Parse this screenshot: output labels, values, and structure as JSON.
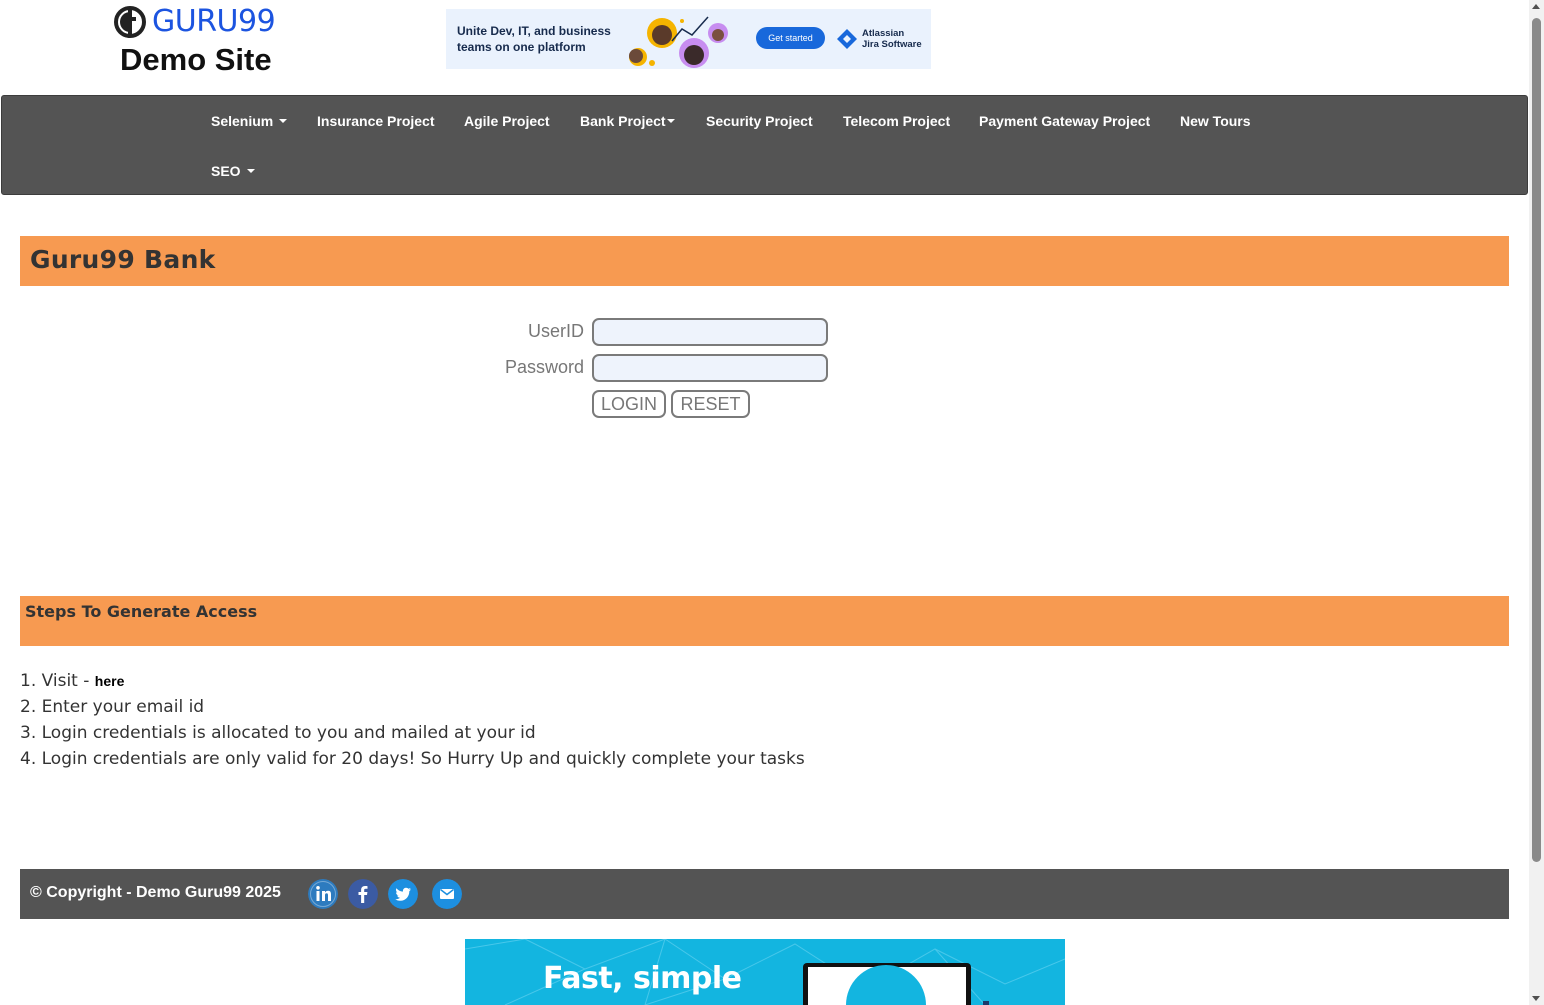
{
  "header": {
    "logo_text": "GURU99",
    "logo_subtitle": "Demo Site"
  },
  "top_ad": {
    "text": "Unite Dev, IT, and business teams on one platform",
    "button": "Get started",
    "brand_line1": "Atlassian",
    "brand_line2": "Jira Software"
  },
  "nav": {
    "items": [
      {
        "label": "Selenium",
        "dropdown": true
      },
      {
        "label": "Insurance Project",
        "dropdown": false
      },
      {
        "label": "Agile Project",
        "dropdown": false
      },
      {
        "label": "Bank Project",
        "dropdown": true
      },
      {
        "label": "Security Project",
        "dropdown": false
      },
      {
        "label": "Telecom Project",
        "dropdown": false
      },
      {
        "label": "Payment Gateway Project",
        "dropdown": false
      },
      {
        "label": "New Tours",
        "dropdown": false
      },
      {
        "label": "SEO",
        "dropdown": true
      }
    ]
  },
  "bank": {
    "title": "Guru99 Bank"
  },
  "login_form": {
    "userid_label": "UserID",
    "userid_value": "",
    "password_label": "Password",
    "password_value": "",
    "login_button": "LOGIN",
    "reset_button": "RESET"
  },
  "steps": {
    "title": "Steps To Generate Access",
    "items": [
      {
        "prefix": "1. Visit - ",
        "link": "here"
      },
      {
        "text": "2. Enter your email id"
      },
      {
        "text": "3. Login credentials is allocated to you and mailed at your id"
      },
      {
        "text": "4. Login credentials are only valid for 20 days! So Hurry Up and quickly complete your tasks"
      }
    ]
  },
  "footer": {
    "copyright": "© Copyright - Demo Guru99 2025",
    "social_icons": [
      "linkedin-icon",
      "facebook-icon",
      "twitter-icon",
      "email-icon"
    ]
  },
  "bottom_ad": {
    "headline": "Fast, simple"
  },
  "colors": {
    "accent_orange": "#f79a51",
    "nav_gray": "#545454",
    "logo_blue": "#1c54e0"
  }
}
